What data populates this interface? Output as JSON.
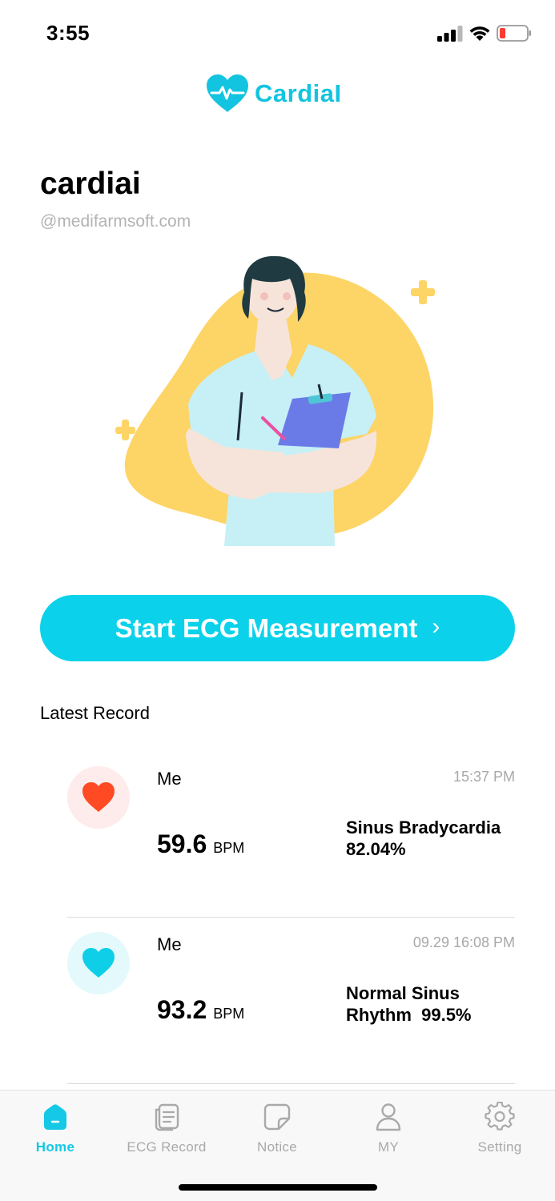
{
  "status_bar": {
    "time": "3:55"
  },
  "app": {
    "name": "CardiaI",
    "brand_color": "#13c4e0"
  },
  "profile": {
    "name": "cardiai",
    "email": "@medifarmsoft.com"
  },
  "cta": {
    "label": "Start ECG Measurement",
    "chevron": "›"
  },
  "latest": {
    "title": "Latest Record",
    "records": [
      {
        "user": "Me",
        "time": "15:37 PM",
        "bpm": "59.6",
        "unit": "BPM",
        "diagnosis_line1": "Sinus Bradycardia",
        "diagnosis_line2": "82.04%",
        "icon": "heart-icon",
        "icon_color": "#ff4a24",
        "icon_bg": "#fdeceb"
      },
      {
        "user": "Me",
        "time": "09.29 16:08 PM",
        "bpm": "93.2",
        "unit": "BPM",
        "diagnosis_line1": "Normal Sinus",
        "diagnosis_line2": "Rhythm  99.5%",
        "icon": "heart-icon",
        "icon_color": "#0fcfe8",
        "icon_bg": "#e3f9fc"
      }
    ]
  },
  "tabs": [
    {
      "label": "Home",
      "icon": "home-icon",
      "active": true
    },
    {
      "label": "ECG Record",
      "icon": "document-icon",
      "active": false
    },
    {
      "label": "Notice",
      "icon": "note-icon",
      "active": false
    },
    {
      "label": "MY",
      "icon": "person-icon",
      "active": false
    },
    {
      "label": "Setting",
      "icon": "gear-icon",
      "active": false
    }
  ],
  "colors": {
    "accent": "#0bd2ea",
    "illustration_blob": "#fdd466"
  }
}
